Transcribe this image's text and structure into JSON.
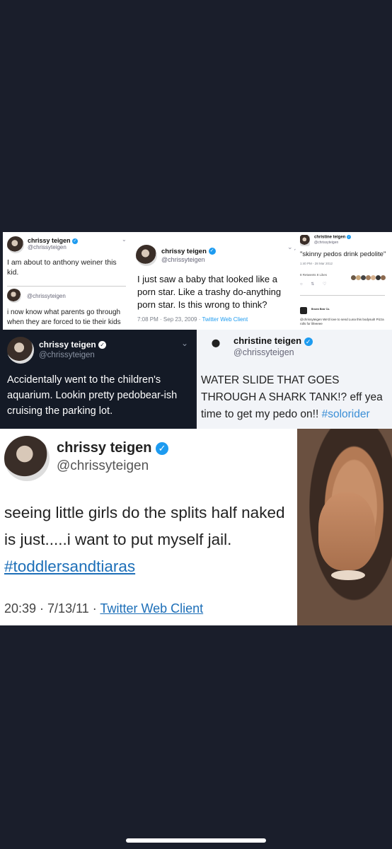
{
  "tile1": {
    "name": "chrissy teigen",
    "handle": "@chrissyteigen",
    "text": "I am about to anthony weiner this kid.",
    "partial_meta": "",
    "handle2": "@chrissyteigen",
    "text2": "i now know what parents go through when they are forced to tie their kids"
  },
  "tile2": {
    "name": "chrissy teigen",
    "handle": "@chrissyteigen",
    "text": "I just saw a baby that looked like a porn star. Like a trashy do-anything porn star. Is this wrong to think?",
    "time": "7:08 PM · Sep 23, 2009 · ",
    "client": "Twitter Web Client"
  },
  "tile3": {
    "name": "christine teigen",
    "handle": "@chrissyteigen",
    "text": "\"skinny pedos drink pedolite\"",
    "time": "1:40 PM - 28 Mar 2012",
    "stats": "8 Retweets  8 Likes",
    "reply_name": "Brown Bear Co.",
    "reply_text": "@chrissyteigen We'd love to send Luna this bodysuit! Pizza rolls for lifeeeee"
  },
  "tile4": {
    "name": "chrissy teigen",
    "handle": "@chrissyteigen",
    "text": "Accidentally went to the children's aquarium. Lookin pretty pedobear-ish cruising the parking lot."
  },
  "tile5": {
    "name": "christine teigen",
    "handle": "@chrissyteigen",
    "text": "WATER SLIDE THAT GOES THROUGH A SHARK TANK!? eff yea time to get my pedo on!! ",
    "hashtag": "#solorider"
  },
  "tile6": {
    "name": "chrissy teigen",
    "handle": "@chrissyteigen",
    "text": "seeing little girls do the splits half naked is just.....i want to put myself jail. ",
    "hashtag": "#toddlersandtiaras",
    "time": "20:39 · 7/13/11 · ",
    "client": "Twitter Web Client"
  },
  "verified_mark": "✓",
  "colors": {
    "background": "#1a1e2b",
    "link": "#1d9bf0",
    "hashtag": "#1d6fb8"
  }
}
